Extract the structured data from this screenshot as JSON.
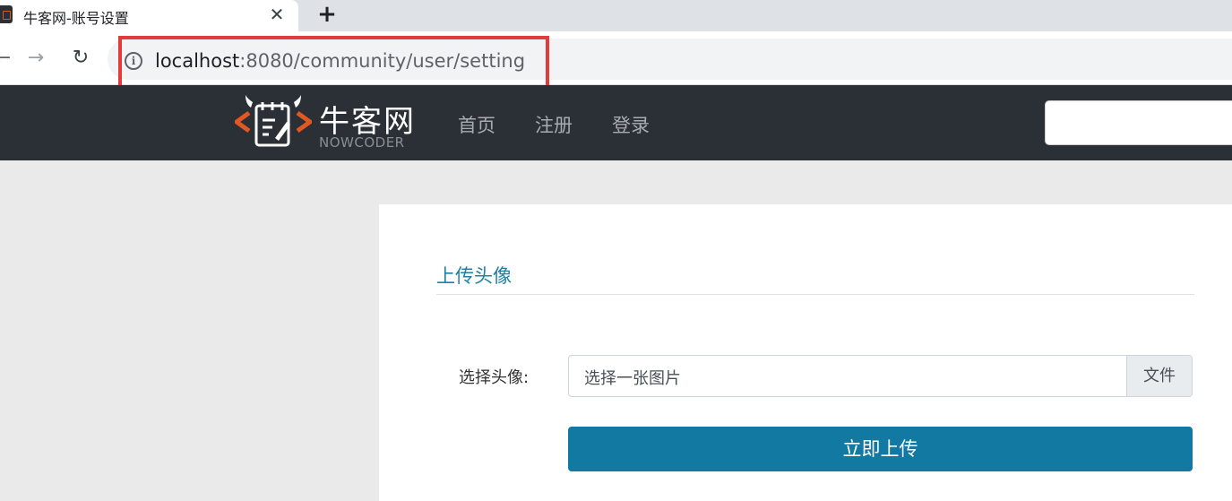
{
  "browser": {
    "tab_title": "牛客网-账号设置",
    "close_glyph": "✕",
    "new_tab_glyph": "+",
    "back_glyph": "←",
    "forward_glyph": "→",
    "reload_glyph": "↻",
    "info_glyph": "i",
    "url_host": "localhost",
    "url_rest": ":8080/community/user/setting",
    "highlight_color": "#e23b3b"
  },
  "site_header": {
    "logo_cn": "牛客网",
    "logo_en": "NOWCODER",
    "nav": {
      "home": "首页",
      "register": "注册",
      "login": "登录"
    }
  },
  "upload_section": {
    "title": "上传头像",
    "field_label": "选择头像:",
    "file_placeholder": "选择一张图片",
    "browse_label": "文件",
    "submit_label": "立即上传"
  },
  "colors": {
    "header_bg": "#2b2f36",
    "accent": "#1279a3",
    "title_color": "#1f7fa6",
    "logo_orange": "#e25822"
  }
}
